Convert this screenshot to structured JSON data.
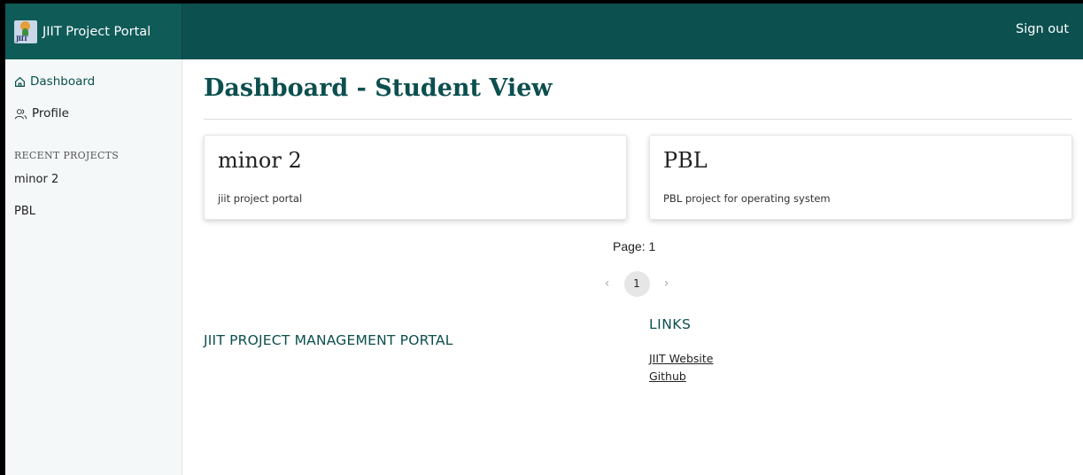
{
  "header": {
    "logo_text": "JIIT",
    "app_title": "JIIT Project Portal",
    "sign_out": "Sign out"
  },
  "sidebar": {
    "nav": [
      {
        "label": "Dashboard",
        "icon": "home-icon",
        "active": true
      },
      {
        "label": "Profile",
        "icon": "users-icon",
        "active": false
      }
    ],
    "recent_heading": "RECENT PROJECTS",
    "recent_projects": [
      "minor 2",
      "PBL"
    ]
  },
  "main": {
    "title": "Dashboard - Student View",
    "cards": [
      {
        "title": "minor 2",
        "description": "jiit project portal"
      },
      {
        "title": "PBL",
        "description": "PBL project for operating system"
      }
    ],
    "page_label": "Page: 1",
    "pagination": {
      "prev_icon": "chevron-left-icon",
      "current": "1",
      "next_icon": "chevron-right-icon"
    }
  },
  "footer": {
    "title": "JIIT PROJECT MANAGEMENT PORTAL",
    "links_heading": "LINKS",
    "links": [
      "JIIT Website",
      "Github"
    ]
  },
  "colors": {
    "header_bg": "#0c5150",
    "accent": "#0c4f4e",
    "sidebar_bg": "#f4f8f8"
  }
}
